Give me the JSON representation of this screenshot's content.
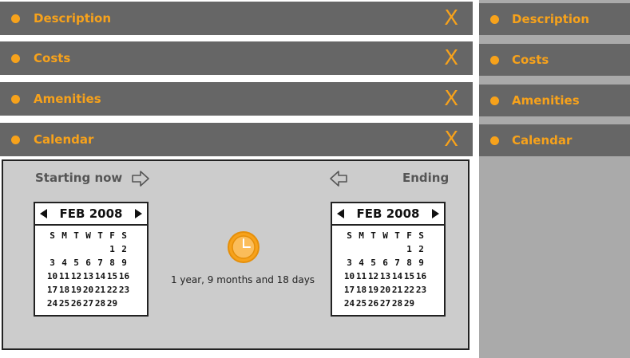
{
  "accordion": [
    {
      "label": "Description",
      "close": "X"
    },
    {
      "label": "Costs",
      "close": "X"
    },
    {
      "label": "Amenities",
      "close": "X"
    },
    {
      "label": "Calendar",
      "close": "X"
    }
  ],
  "sidebar": {
    "items": [
      {
        "label": "Description"
      },
      {
        "label": "Costs"
      },
      {
        "label": "Amenities"
      },
      {
        "label": "Calendar"
      }
    ]
  },
  "calendar_panel": {
    "start_label": "Starting now",
    "end_label": "Ending",
    "duration": "1 year, 9 months and 18 days",
    "start_calendar": {
      "month": "FEB 2008",
      "weekdays": [
        "S",
        "M",
        "T",
        "W",
        "T",
        "F",
        "S"
      ],
      "weeks": [
        [
          "",
          "",
          "",
          "",
          "",
          "1",
          "2"
        ],
        [
          "3",
          "4",
          "5",
          "6",
          "7",
          "8",
          "9"
        ],
        [
          "10",
          "11",
          "12",
          "13",
          "14",
          "15",
          "16"
        ],
        [
          "17",
          "18",
          "19",
          "20",
          "21",
          "22",
          "23"
        ],
        [
          "24",
          "25",
          "26",
          "27",
          "28",
          "29",
          ""
        ]
      ]
    },
    "end_calendar": {
      "month": "FEB 2008",
      "weekdays": [
        "S",
        "M",
        "T",
        "W",
        "T",
        "F",
        "S"
      ],
      "weeks": [
        [
          "",
          "",
          "",
          "",
          "",
          "1",
          "2"
        ],
        [
          "3",
          "4",
          "5",
          "6",
          "7",
          "8",
          "9"
        ],
        [
          "10",
          "11",
          "12",
          "13",
          "14",
          "15",
          "16"
        ],
        [
          "17",
          "18",
          "19",
          "20",
          "21",
          "22",
          "23"
        ],
        [
          "24",
          "25",
          "26",
          "27",
          "28",
          "29",
          ""
        ]
      ]
    }
  },
  "colors": {
    "accent": "#f7a21b",
    "bar": "#666666",
    "panel": "#cccccc",
    "sidebar_bg": "#aaaaaa"
  },
  "icons": [
    "bullet-dot-icon",
    "close-x-icon",
    "arrow-right-icon",
    "arrow-left-icon",
    "clock-icon",
    "chevron-left-icon",
    "chevron-right-icon"
  ]
}
